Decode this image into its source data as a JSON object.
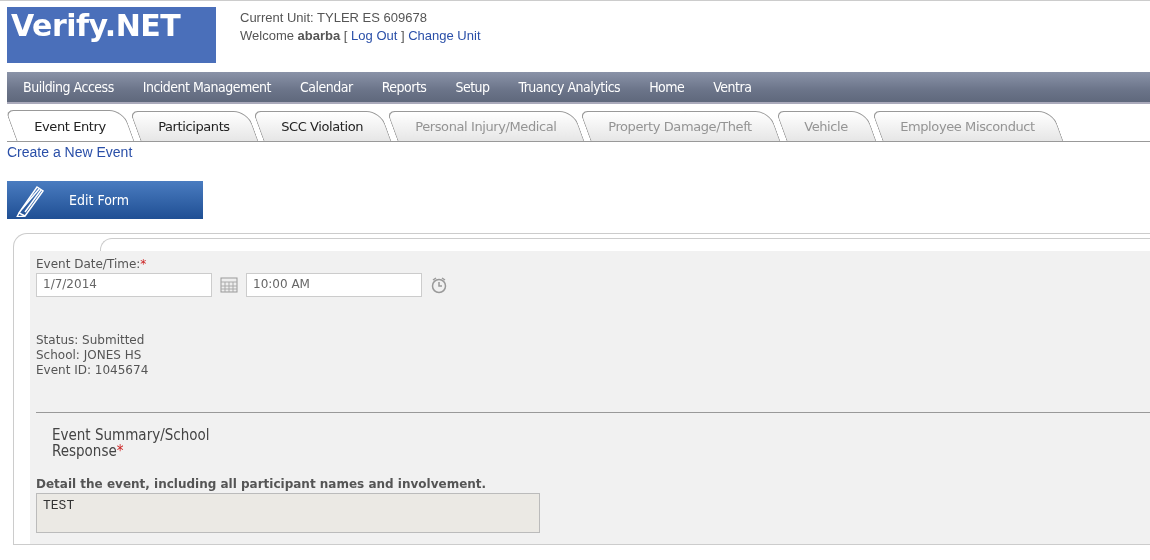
{
  "logo": "Verify.NET",
  "header": {
    "unit": "Current Unit: TYLER ES 609678",
    "welcome": "Welcome",
    "user": "abarba",
    "bracket_open": "[",
    "logout": "Log Out",
    "bracket_close": "]",
    "change_unit": "Change Unit"
  },
  "nav": [
    "Building Access",
    "Incident Management",
    "Calendar",
    "Reports",
    "Setup",
    "Truancy Analytics",
    "Home",
    "Ventra"
  ],
  "tabs": [
    {
      "label": "Event Entry",
      "selected": true,
      "disabled": false
    },
    {
      "label": "Participants",
      "selected": false,
      "disabled": false
    },
    {
      "label": "SCC Violation",
      "selected": false,
      "disabled": false
    },
    {
      "label": "Personal Injury/Medical",
      "selected": false,
      "disabled": true
    },
    {
      "label": "Property Damage/Theft",
      "selected": false,
      "disabled": true
    },
    {
      "label": "Vehicle",
      "selected": false,
      "disabled": true
    },
    {
      "label": "Employee Misconduct",
      "selected": false,
      "disabled": true
    }
  ],
  "create_link": "Create a New Event",
  "edit_button": "Edit Form",
  "form": {
    "date_label": "Event Date/Time:",
    "required_mark": "*",
    "date_value": "1/7/2014",
    "time_value": "10:00 AM",
    "info": [
      "Status: Submitted",
      "School: JONES HS",
      "Event ID: 1045674"
    ],
    "summary_title": "Event Summary/School Response",
    "summary_required_mark": "*",
    "detail_prompt": "Detail the event, including all participant names and involvement.",
    "detail_value": "TEST"
  }
}
